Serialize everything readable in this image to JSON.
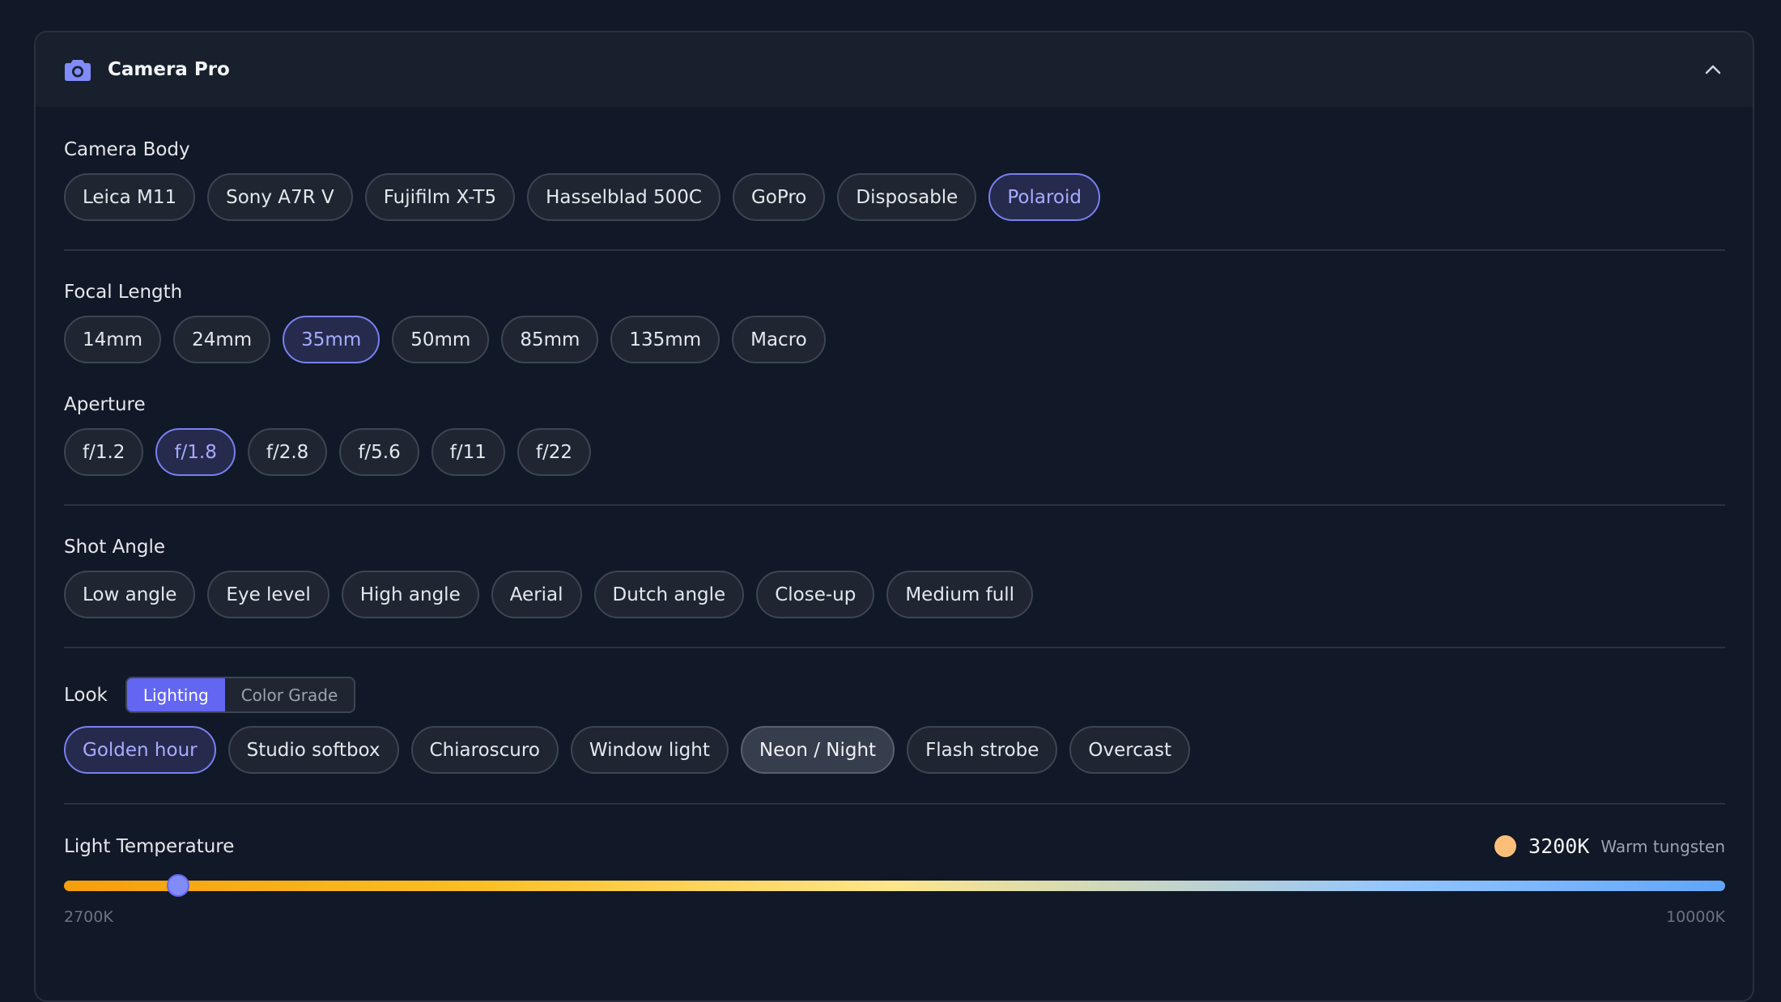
{
  "header": {
    "title": "Camera Pro"
  },
  "camera_body": {
    "label": "Camera Body",
    "options": [
      "Leica M11",
      "Sony A7R V",
      "Fujifilm X-T5",
      "Hasselblad 500C",
      "GoPro",
      "Disposable",
      "Polaroid"
    ],
    "selected": "Polaroid"
  },
  "focal_length": {
    "label": "Focal Length",
    "options": [
      "14mm",
      "24mm",
      "35mm",
      "50mm",
      "85mm",
      "135mm",
      "Macro"
    ],
    "selected": "35mm"
  },
  "aperture": {
    "label": "Aperture",
    "options": [
      "f/1.2",
      "f/1.8",
      "f/2.8",
      "f/5.6",
      "f/11",
      "f/22"
    ],
    "selected": "f/1.8"
  },
  "shot_angle": {
    "label": "Shot Angle",
    "options": [
      "Low angle",
      "Eye level",
      "High angle",
      "Aerial",
      "Dutch angle",
      "Close-up",
      "Medium full"
    ]
  },
  "look": {
    "label": "Look",
    "tabs": [
      "Lighting",
      "Color Grade"
    ],
    "active_tab": "Lighting",
    "options": [
      "Golden hour",
      "Studio softbox",
      "Chiaroscuro",
      "Window light",
      "Neon / Night",
      "Flash strobe",
      "Overcast"
    ],
    "selected": "Golden hour",
    "hovered": "Neon / Night"
  },
  "light_temperature": {
    "label": "Light Temperature",
    "value_text": "3200K",
    "description": "Warm tungsten",
    "min_label": "2700K",
    "max_label": "10000K",
    "value": 3200,
    "min": 2700,
    "max": 10000
  },
  "colors": {
    "accent": "#6366f1",
    "selected_text": "#a8abff",
    "background": "#111827",
    "warm_dot": "#fbbf7a"
  },
  "icons": {
    "header": "camera-icon",
    "collapse": "chevron-up-icon"
  }
}
